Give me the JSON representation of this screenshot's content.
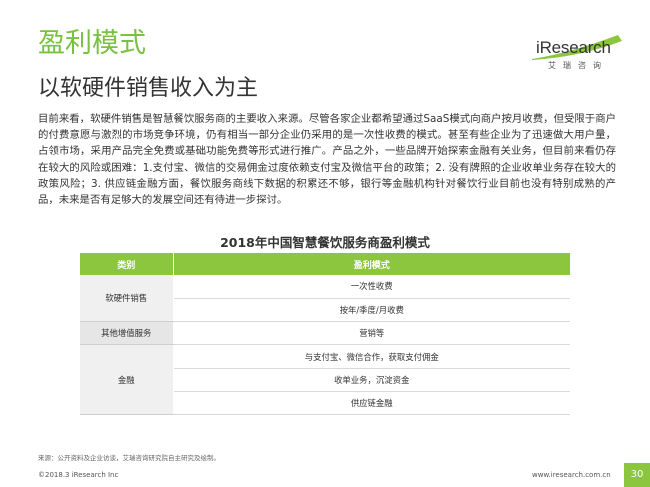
{
  "header": {
    "title": "盈利模式",
    "subtitle": "以软硬件销售收入为主"
  },
  "logo": {
    "brand": "iResearch",
    "brand_cn": "艾瑞咨询"
  },
  "body": {
    "paragraph": "目前来看，软硬件销售是智慧餐饮服务商的主要收入来源。尽管各家企业都希望通过SaaS模式向商户按月收费，但受限于商户的付费意愿与激烈的市场竞争环境，仍有相当一部分企业仍采用的是一次性收费的模式。甚至有些企业为了迅速做大用户量，占领市场，采用产品完全免费或基础功能免费等形式进行推广。产品之外，一些品牌开始探索金融有关业务，但目前来看仍存在较大的风险或困难：1.支付宝、微信的交易佣金过度依赖支付宝及微信平台的政策；2. 没有牌照的企业收单业务存在较大的政策风险；3. 供应链金融方面，餐饮服务商线下数据的积累还不够，银行等金融机构针对餐饮行业目前也没有特别成熟的产品，未来是否有足够大的发展空间还有待进一步探讨。"
  },
  "table": {
    "title": "2018年中国智慧餐饮服务商盈利模式",
    "col_category": "类别",
    "col_model": "盈利模式",
    "groups": [
      {
        "category": "软硬件销售",
        "items": [
          "一次性收费",
          "按年/季度/月收费"
        ]
      },
      {
        "category": "其他增值服务",
        "items": [
          "营销等"
        ]
      },
      {
        "category": "金融",
        "items": [
          "与支付宝、微信合作，获取支付佣金",
          "收单业务，沉淀资金",
          "供应链金融"
        ]
      }
    ]
  },
  "footer": {
    "source": "来源：公开资料及企业访谈，艾瑞咨询研究院自主研究及绘制。",
    "copyright": "©2018.3 iResearch Inc",
    "url": "www.iresearch.com.cn",
    "page": "30"
  },
  "colors": {
    "accent": "#8cc63f",
    "title_green": "#7ac143"
  }
}
